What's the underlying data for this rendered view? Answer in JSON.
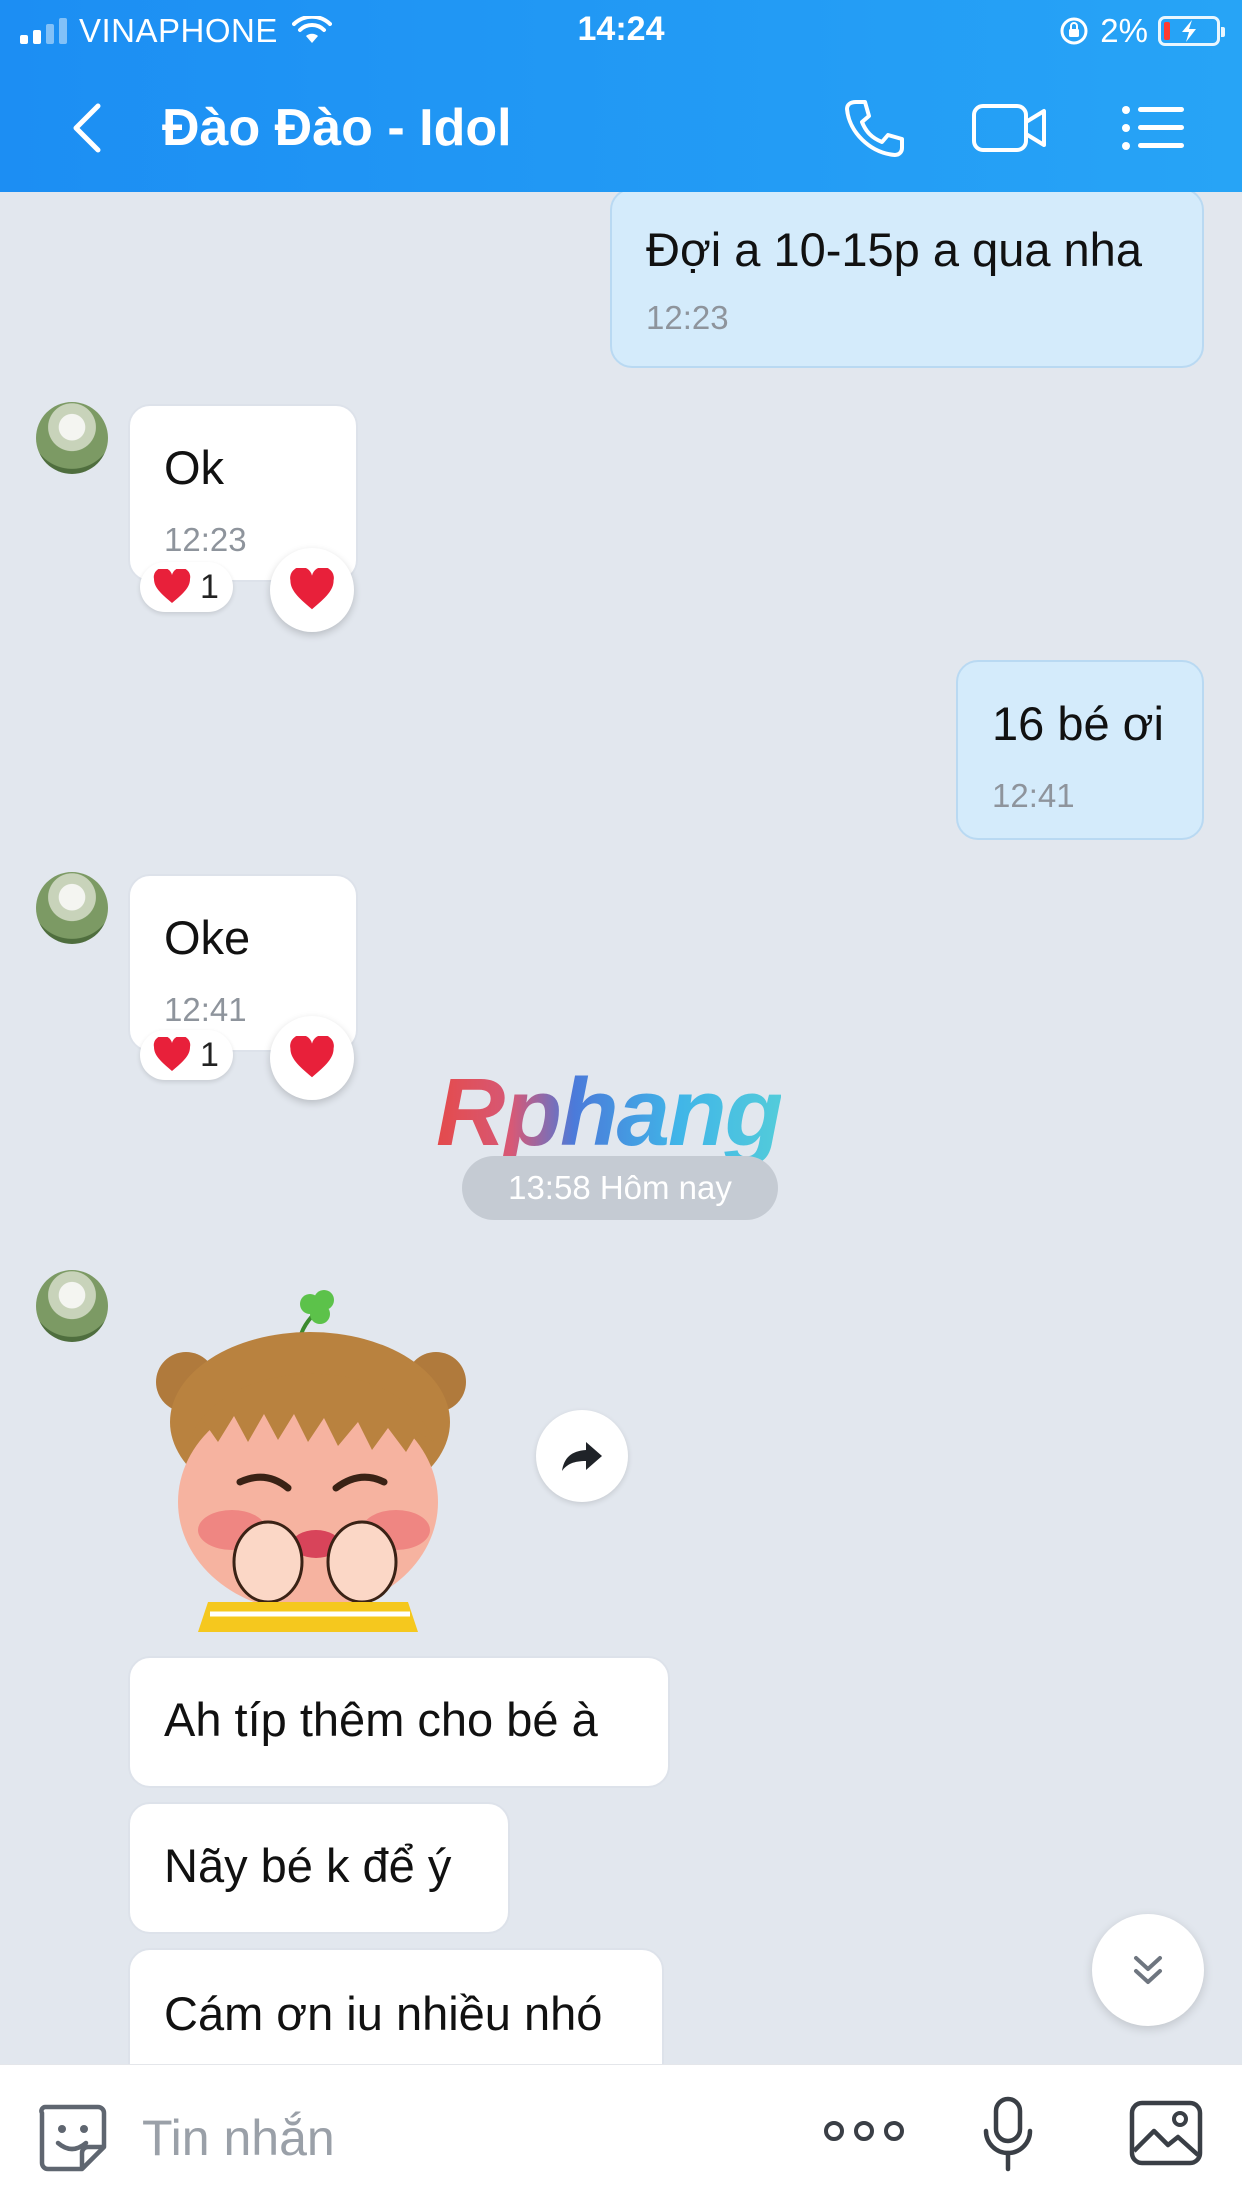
{
  "status_bar": {
    "carrier": "VINAPHONE",
    "time": "14:24",
    "battery": "2%"
  },
  "header": {
    "title": "Đào Đào - Idol"
  },
  "messages": [
    {
      "direction": "out",
      "text": "Đợi a 10-15p a qua nha",
      "time": "12:23"
    },
    {
      "direction": "in",
      "text": "Ok",
      "time": "12:23",
      "reaction_count": "1"
    },
    {
      "direction": "out",
      "text": "16 bé ơi",
      "time": "12:41"
    },
    {
      "direction": "in",
      "text": "Oke",
      "time": "12:41",
      "reaction_count": "1"
    },
    {
      "direction": "in",
      "text": "Ah típ thêm cho bé à"
    },
    {
      "direction": "in",
      "text": "Nãy bé k để ý"
    },
    {
      "direction": "in",
      "text": "Cám ơn iu nhiều nhó"
    }
  ],
  "date_separator": "13:58 Hôm nay",
  "watermark": "Rphang",
  "input": {
    "placeholder": "Tin nhắn"
  },
  "colors": {
    "header": "#1c8ef3",
    "outgoing_bubble": "#d4ebfb",
    "incoming_bubble": "#ffffff",
    "chat_background": "#e2e7ee",
    "heart": "#e8203a"
  },
  "icons": [
    "back-icon",
    "phone-icon",
    "video-call-icon",
    "menu-icon",
    "heart-icon",
    "share-icon",
    "chevron-double-down-icon",
    "sticker-icon",
    "more-icon",
    "microphone-icon",
    "image-icon"
  ]
}
